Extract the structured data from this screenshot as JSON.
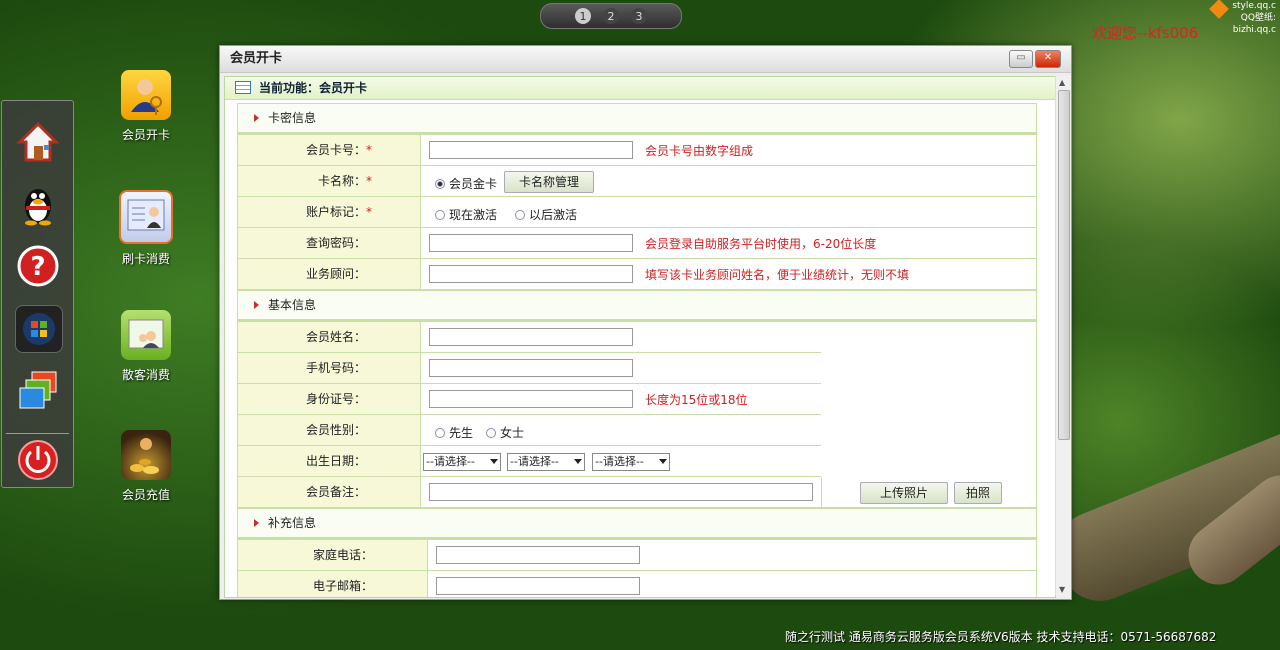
{
  "pager": {
    "pages": [
      "1",
      "2",
      "3"
    ],
    "active": "1"
  },
  "welcome": "欢迎您--kfs006",
  "corner_logo": {
    "line1": "style.qq.c",
    "line2": "QQ壁纸: bizhi.qq.c"
  },
  "dock": {
    "items": [
      "home-icon",
      "qq-penguin-icon",
      "help-icon",
      "windows-icon",
      "windows-stack-icon",
      "power-icon"
    ]
  },
  "desktop_icons": [
    {
      "label": "会员开卡",
      "icon": "member-card-icon"
    },
    {
      "label": "刷卡消费",
      "icon": "swipe-card-icon"
    },
    {
      "label": "散客消费",
      "icon": "guest-icon"
    },
    {
      "label": "会员充值",
      "icon": "coins-icon"
    }
  ],
  "window": {
    "title": "会员开卡",
    "function_bar": "当前功能：会员开卡",
    "sections": {
      "card": "卡密信息",
      "basic": "基本信息",
      "extra": "补充信息"
    },
    "card": {
      "card_no_label": "会员卡号：",
      "card_no_hint": "会员卡号由数字组成",
      "card_name_label": "卡名称：",
      "card_name_option": "会员金卡",
      "card_name_button": "卡名称管理",
      "account_label": "账户标记：",
      "account_opt1": "现在激活",
      "account_opt2": "以后激活",
      "query_pwd_label": "查询密码：",
      "query_pwd_hint": "会员登录自助服务平台时使用，6-20位长度",
      "advisor_label": "业务顾问：",
      "advisor_hint": "填写该卡业务顾问姓名，便于业绩统计，无则不填",
      "required_mark": "*"
    },
    "basic": {
      "name_label": "会员姓名：",
      "phone_label": "手机号码：",
      "id_label": "身份证号：",
      "id_hint": "长度为15位或18位",
      "gender_label": "会员性别：",
      "gender_male": "先生",
      "gender_female": "女士",
      "birth_label": "出生日期：",
      "birth_year": "--请选择--",
      "birth_month": "--请选择--",
      "birth_day": "--请选择--",
      "note_label": "会员备注：",
      "upload_button": "上传照片",
      "photo_button": "拍照"
    },
    "extra": {
      "home_phone_label": "家庭电话：",
      "email_label": "电子邮箱："
    }
  },
  "status_bar": "随之行测试 通易商务云服务版会员系统V6版本 技术支持电话：0571-56687682"
}
